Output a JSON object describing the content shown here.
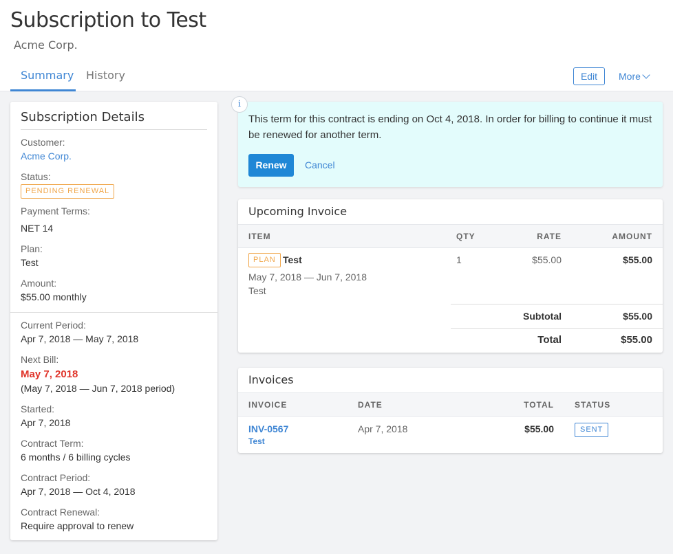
{
  "header": {
    "title": "Subscription to Test",
    "subtitle": "Acme Corp.",
    "tabs": [
      {
        "label": "Summary"
      },
      {
        "label": "History"
      }
    ],
    "edit_label": "Edit",
    "more_label": "More"
  },
  "details": {
    "title": "Subscription Details",
    "customer_label": "Customer:",
    "customer_value": "Acme Corp.",
    "status_label": "Status:",
    "status_value": "PENDING RENEWAL",
    "payment_terms_label": "Payment Terms:",
    "payment_terms_value": "NET 14",
    "plan_label": "Plan:",
    "plan_value": "Test",
    "amount_label": "Amount:",
    "amount_value": "$55.00 monthly",
    "current_period_label": "Current Period:",
    "current_period_value": "Apr 7, 2018 — May 7, 2018",
    "next_bill_label": "Next Bill:",
    "next_bill_value": "May 7, 2018",
    "next_bill_period": "(May 7, 2018 — Jun 7, 2018 period)",
    "started_label": "Started:",
    "started_value": "Apr 7, 2018",
    "contract_term_label": "Contract Term:",
    "contract_term_value": "6 months / 6 billing cycles",
    "contract_period_label": "Contract Period:",
    "contract_period_value": "Apr 7, 2018 — Oct 4, 2018",
    "contract_renewal_label": "Contract Renewal:",
    "contract_renewal_value": "Require approval to renew"
  },
  "notice": {
    "icon": "i",
    "text": "This term for this contract is ending on Oct 4, 2018. In order for billing to continue it must be renewed for another term.",
    "renew_label": "Renew",
    "cancel_label": "Cancel"
  },
  "upcoming": {
    "title": "Upcoming Invoice",
    "columns": [
      "ITEM",
      "QTY",
      "RATE",
      "AMOUNT"
    ],
    "row": {
      "badge": "PLAN",
      "name": "Test",
      "period": "May 7, 2018 — Jun 7, 2018",
      "desc": "Test",
      "qty": "1",
      "rate": "$55.00",
      "amount": "$55.00"
    },
    "subtotal_label": "Subtotal",
    "subtotal_value": "$55.00",
    "total_label": "Total",
    "total_value": "$55.00"
  },
  "invoices": {
    "title": "Invoices",
    "columns": [
      "INVOICE",
      "DATE",
      "TOTAL",
      "STATUS"
    ],
    "rows": [
      {
        "number": "INV-0567",
        "sub": "Test",
        "date": "Apr 7, 2018",
        "total": "$55.00",
        "status": "SENT"
      }
    ]
  }
}
